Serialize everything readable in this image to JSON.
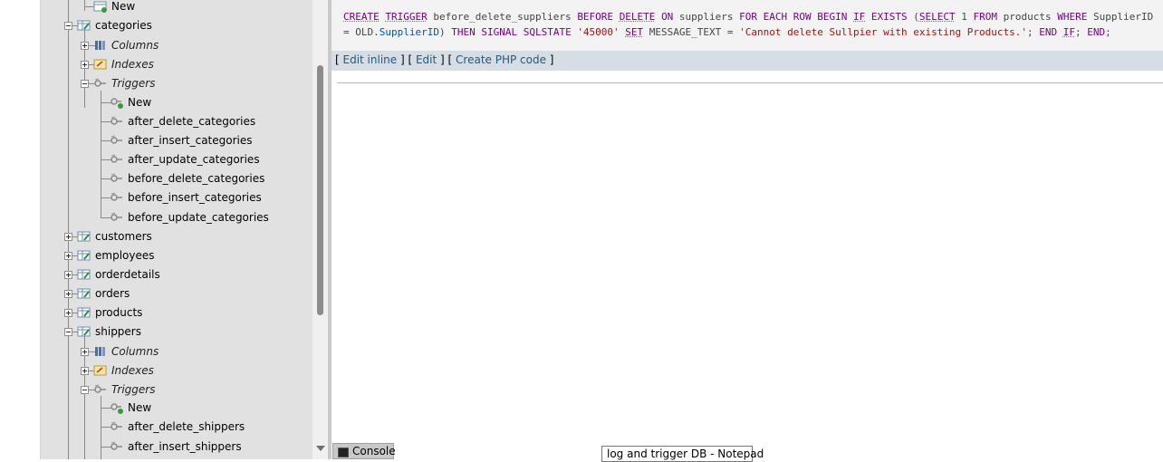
{
  "nav": {
    "tree": [
      {
        "label": "New",
        "kind": "new-table",
        "italic": false
      },
      {
        "label": "categories",
        "kind": "table",
        "italic": false
      },
      {
        "label": "Columns",
        "kind": "columns",
        "italic": true
      },
      {
        "label": "Indexes",
        "kind": "indexes",
        "italic": true
      },
      {
        "label": "Triggers",
        "kind": "triggers",
        "italic": true
      },
      {
        "label": "New",
        "kind": "new-trigger",
        "italic": false
      },
      {
        "label": "after_delete_categories",
        "kind": "trigger",
        "italic": false
      },
      {
        "label": "after_insert_categories",
        "kind": "trigger",
        "italic": false
      },
      {
        "label": "after_update_categories",
        "kind": "trigger",
        "italic": false
      },
      {
        "label": "before_delete_categories",
        "kind": "trigger",
        "italic": false
      },
      {
        "label": "before_insert_categories",
        "kind": "trigger",
        "italic": false
      },
      {
        "label": "before_update_categories",
        "kind": "trigger",
        "italic": false
      },
      {
        "label": "customers",
        "kind": "table",
        "italic": false
      },
      {
        "label": "employees",
        "kind": "table",
        "italic": false
      },
      {
        "label": "orderdetails",
        "kind": "table",
        "italic": false
      },
      {
        "label": "orders",
        "kind": "table",
        "italic": false
      },
      {
        "label": "products",
        "kind": "table",
        "italic": false
      },
      {
        "label": "shippers",
        "kind": "table",
        "italic": false
      },
      {
        "label": "Columns",
        "kind": "columns",
        "italic": true
      },
      {
        "label": "Indexes",
        "kind": "indexes",
        "italic": true
      },
      {
        "label": "Triggers",
        "kind": "triggers",
        "italic": true
      },
      {
        "label": "New",
        "kind": "new-trigger",
        "italic": false
      },
      {
        "label": "after_delete_shippers",
        "kind": "trigger",
        "italic": false
      },
      {
        "label": "after_insert_shippers",
        "kind": "trigger",
        "italic": false
      }
    ]
  },
  "sql": {
    "tokens": [
      {
        "t": "CREATE",
        "c": "kw und"
      },
      {
        "t": " "
      },
      {
        "t": "TRIGGER",
        "c": "kw und"
      },
      {
        "t": " before_delete_suppliers "
      },
      {
        "t": "BEFORE",
        "c": "kw"
      },
      {
        "t": " "
      },
      {
        "t": "DELETE",
        "c": "kw und"
      },
      {
        "t": " "
      },
      {
        "t": "ON",
        "c": "kw"
      },
      {
        "t": " suppliers "
      },
      {
        "t": "FOR EACH ROW BEGIN",
        "c": "kw"
      },
      {
        "t": " "
      },
      {
        "t": "IF",
        "c": "kw und"
      },
      {
        "t": " "
      },
      {
        "t": "EXISTS",
        "c": "kw"
      },
      {
        "t": " ("
      },
      {
        "t": "SELECT",
        "c": "kw und"
      },
      {
        "t": " "
      },
      {
        "t": "1",
        "c": "num"
      },
      {
        "t": " "
      },
      {
        "t": "FROM",
        "c": "kw"
      },
      {
        "t": " products "
      },
      {
        "t": "WHERE",
        "c": "kw"
      },
      {
        "t": " SupplierID = OLD."
      },
      {
        "t": "SupplierID",
        "c": "var"
      },
      {
        "t": ") "
      },
      {
        "t": "THEN SIGNAL SQLSTATE",
        "c": "kw"
      },
      {
        "t": " "
      },
      {
        "t": "'45000'",
        "c": "str"
      },
      {
        "t": " "
      },
      {
        "t": "SET",
        "c": "kw und"
      },
      {
        "t": " MESSAGE_TEXT = "
      },
      {
        "t": "'Cannot delete Sullpier with existing Products.'",
        "c": "str"
      },
      {
        "t": "; "
      },
      {
        "t": "END",
        "c": "kw"
      },
      {
        "t": " "
      },
      {
        "t": "IF",
        "c": "kw und"
      },
      {
        "t": "; "
      },
      {
        "t": "END",
        "c": "kw"
      },
      {
        "t": ";"
      }
    ]
  },
  "actions": {
    "edit_inline": "Edit inline",
    "edit": "Edit",
    "create_php": "Create PHP code"
  },
  "console": {
    "label": "Console"
  },
  "taskbar_tooltip": "log and trigger DB - Notepad"
}
